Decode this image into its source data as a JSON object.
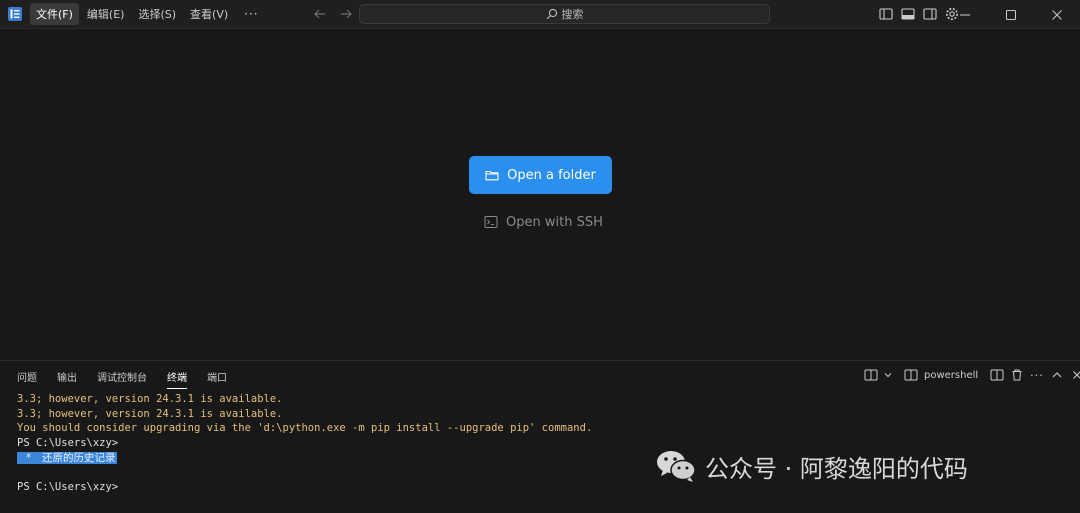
{
  "titlebar": {
    "menu": [
      "文件(F)",
      "编辑(E)",
      "选择(S)",
      "查看(V)"
    ],
    "more": "···",
    "search_placeholder": "搜索"
  },
  "welcome": {
    "open_folder": "Open a folder",
    "open_ssh": "Open with SSH"
  },
  "panel": {
    "tabs": [
      "问题",
      "输出",
      "调试控制台",
      "终端",
      "端口"
    ],
    "active_tab": "终端",
    "shell": "powershell"
  },
  "terminal": {
    "lines": [
      "3.3; however, version 24.3.1 is available.",
      "3.3; however, version 24.3.1 is available.",
      "You should consider upgrading via the 'd:\\python.exe -m pip install --upgrade pip' command.",
      "PS C:\\Users\\xzy>"
    ],
    "highlight_marker": " * ",
    "highlight_text": "还原的历史记录",
    "last_prompt": "PS C:\\Users\\xzy>"
  },
  "watermark": {
    "text": "公众号 · 阿黎逸阳的代码"
  },
  "colors": {
    "accent": "#2b8ff0",
    "warning_text": "#e5c07b",
    "background": "#181818"
  }
}
